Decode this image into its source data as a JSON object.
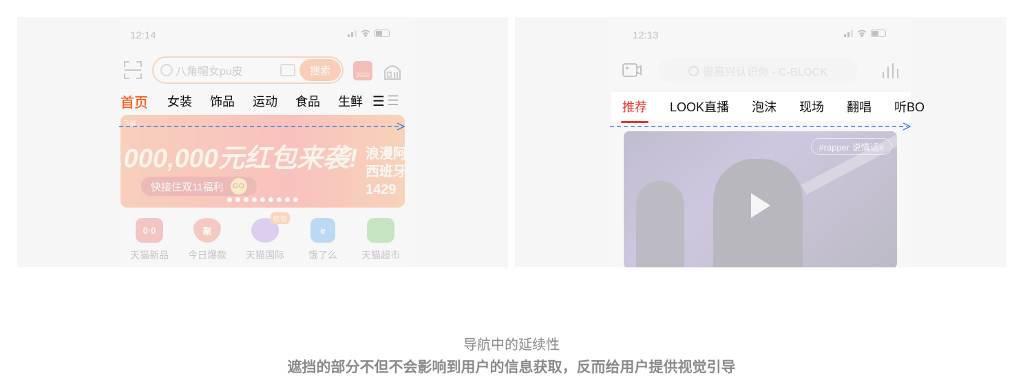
{
  "left_phone": {
    "status_time": "12:14",
    "search_placeholder": "八角帽女pu皮",
    "search_button": "搜索",
    "badge": "2020",
    "tabs": [
      "首页",
      "女装",
      "饰品",
      "运动",
      "食品",
      "生鲜"
    ],
    "menu_glyph": "☰",
    "banner": {
      "corner": "飞猪",
      "headline": ",000,000元红包来袭!",
      "pill": "快接住双11福利",
      "go": "GO",
      "side_line1": "浪漫阿",
      "side_line2": "西班牙",
      "side_line3": "1429"
    },
    "shortcuts": [
      {
        "label": "天猫新品",
        "icon": "tmall-cat-icon",
        "glyph": "0·0",
        "color": "#e8473f"
      },
      {
        "label": "今日爆款",
        "icon": "juhuasuan-drop-icon",
        "glyph": "聚",
        "color": "#f0583c"
      },
      {
        "label": "天猫国际",
        "icon": "planet-icon",
        "glyph": "",
        "color": "#9b6be0"
      },
      {
        "label": "饿了么",
        "icon": "eleme-icon",
        "glyph": "e",
        "color": "#2a8ff0"
      },
      {
        "label": "天猫超市",
        "icon": "shopping-cart-icon",
        "glyph": "",
        "color": "#52b83a"
      }
    ],
    "planet_badge": "红包"
  },
  "right_phone": {
    "status_time": "12:13",
    "search_placeholder": "很高兴认识你 - C-BLOCK",
    "tabs": [
      "推荐",
      "LOOK直播",
      "泡沫",
      "现场",
      "翻唱",
      "听BO"
    ],
    "video_hashtag": "#rapper 说情话#"
  },
  "caption": {
    "title": "导航中的延续性",
    "subtitle": "遮挡的部分不但不会影响到用户的信息获取，反而给用户提供视觉引导"
  },
  "colors": {
    "taobao_orange": "#ff6b1a",
    "netease_red": "#e8342c",
    "arrow_blue": "#3b7fe0",
    "caption_gray": "#8a8a8a"
  }
}
